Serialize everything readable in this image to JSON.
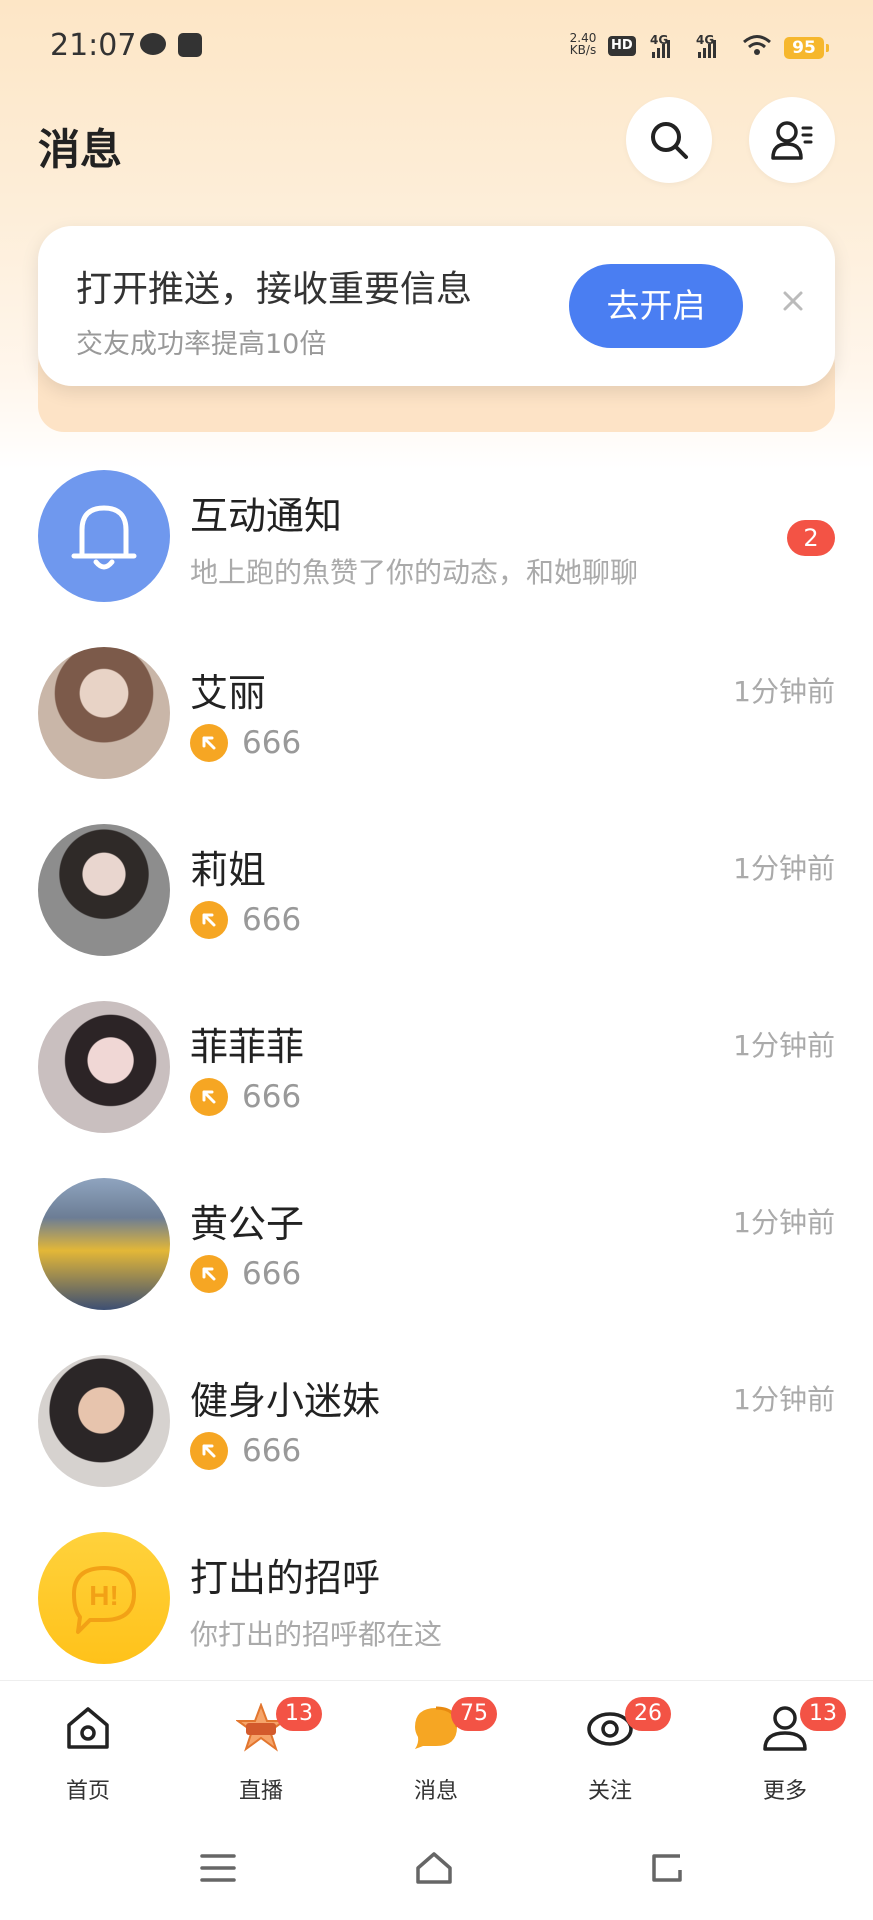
{
  "status_bar": {
    "time": "21:07",
    "net_speed": "2.40\nKB/s",
    "hd_label": "HD",
    "network_1": "4G",
    "network_2": "4G",
    "battery": "95"
  },
  "header": {
    "title": "消息",
    "search_icon": "search-icon",
    "contacts_icon": "user-list-icon"
  },
  "push_card": {
    "title": "打开推送，接收重要信息",
    "subtitle": "交友成功率提高10倍",
    "button": "去开启",
    "close_icon": "close-icon"
  },
  "messages": [
    {
      "name": "互动通知",
      "preview": "地上跑的魚赞了你的动态，和她聊聊",
      "badge": "2",
      "type": "notification"
    },
    {
      "name": "艾丽",
      "time": "1分钟前",
      "gift_count": "666",
      "avatar_colors": [
        "#c9b6a8",
        "#7c5a4a",
        "#e8d3c6"
      ]
    },
    {
      "name": "莉姐",
      "time": "1分钟前",
      "gift_count": "666",
      "avatar_colors": [
        "#8d8d8d",
        "#2f2a28",
        "#e9c0c6"
      ]
    },
    {
      "name": "菲菲菲",
      "time": "1分钟前",
      "gift_count": "666",
      "avatar_colors": [
        "#c9bfbf",
        "#2c2426",
        "#f0d7d5"
      ]
    },
    {
      "name": "黄公子",
      "time": "1分钟前",
      "gift_count": "666",
      "avatar_colors": [
        "#6c7d95",
        "#e3b737",
        "#3d4f73"
      ]
    },
    {
      "name": "健身小迷妹",
      "time": "1分钟前",
      "gift_count": "666",
      "avatar_colors": [
        "#d6d2cf",
        "#2b2627",
        "#e7c4ad"
      ]
    },
    {
      "name": "打出的招呼",
      "preview": "你打出的招呼都在这",
      "type": "greeting",
      "icon_text": "H!"
    }
  ],
  "bottom_nav": [
    {
      "label": "首页",
      "icon": "home-icon"
    },
    {
      "label": "直播",
      "icon": "live-icon",
      "badge": "13"
    },
    {
      "label": "消息",
      "icon": "message-icon",
      "badge": "75"
    },
    {
      "label": "关注",
      "icon": "follow-icon",
      "badge": "26"
    },
    {
      "label": "更多",
      "icon": "profile-icon",
      "badge": "13"
    }
  ],
  "colors": {
    "accent_blue": "#4a7ef2",
    "badge_red": "#f35345",
    "gift_orange": "#f6a623",
    "greeting_yellow": "#ffc82a"
  }
}
